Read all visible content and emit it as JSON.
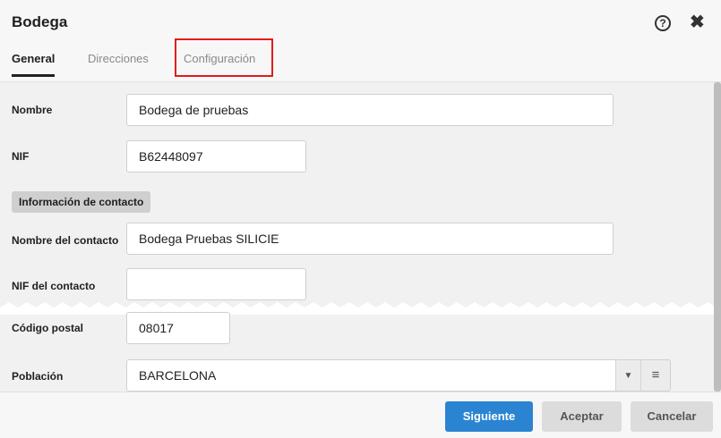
{
  "window": {
    "title": "Bodega"
  },
  "tabs": [
    {
      "label": "General"
    },
    {
      "label": "Direcciones"
    },
    {
      "label": "Configuración"
    }
  ],
  "form": {
    "nombre": {
      "label": "Nombre",
      "value": "Bodega de pruebas"
    },
    "nif": {
      "label": "NIF",
      "value": "B62448097"
    },
    "section_contact": "Información de contacto",
    "nombre_contacto": {
      "label": "Nombre del contacto",
      "value": "Bodega Pruebas SILICIE"
    },
    "nif_contacto": {
      "label": "NIF del contacto",
      "value": ""
    },
    "codigo_postal": {
      "label": "Código postal",
      "value": "08017"
    },
    "poblacion": {
      "label": "Población",
      "value": "BARCELONA"
    }
  },
  "footer": {
    "siguiente": "Siguiente",
    "aceptar": "Aceptar",
    "cancelar": "Cancelar"
  },
  "icons": {
    "help": "help-circle-icon",
    "close": "close-x-icon",
    "dropdown": "caret-down-icon",
    "menu": "hamburger-menu-icon"
  },
  "colors": {
    "accent": "#2a84d2",
    "highlight": "#e21b1b"
  }
}
